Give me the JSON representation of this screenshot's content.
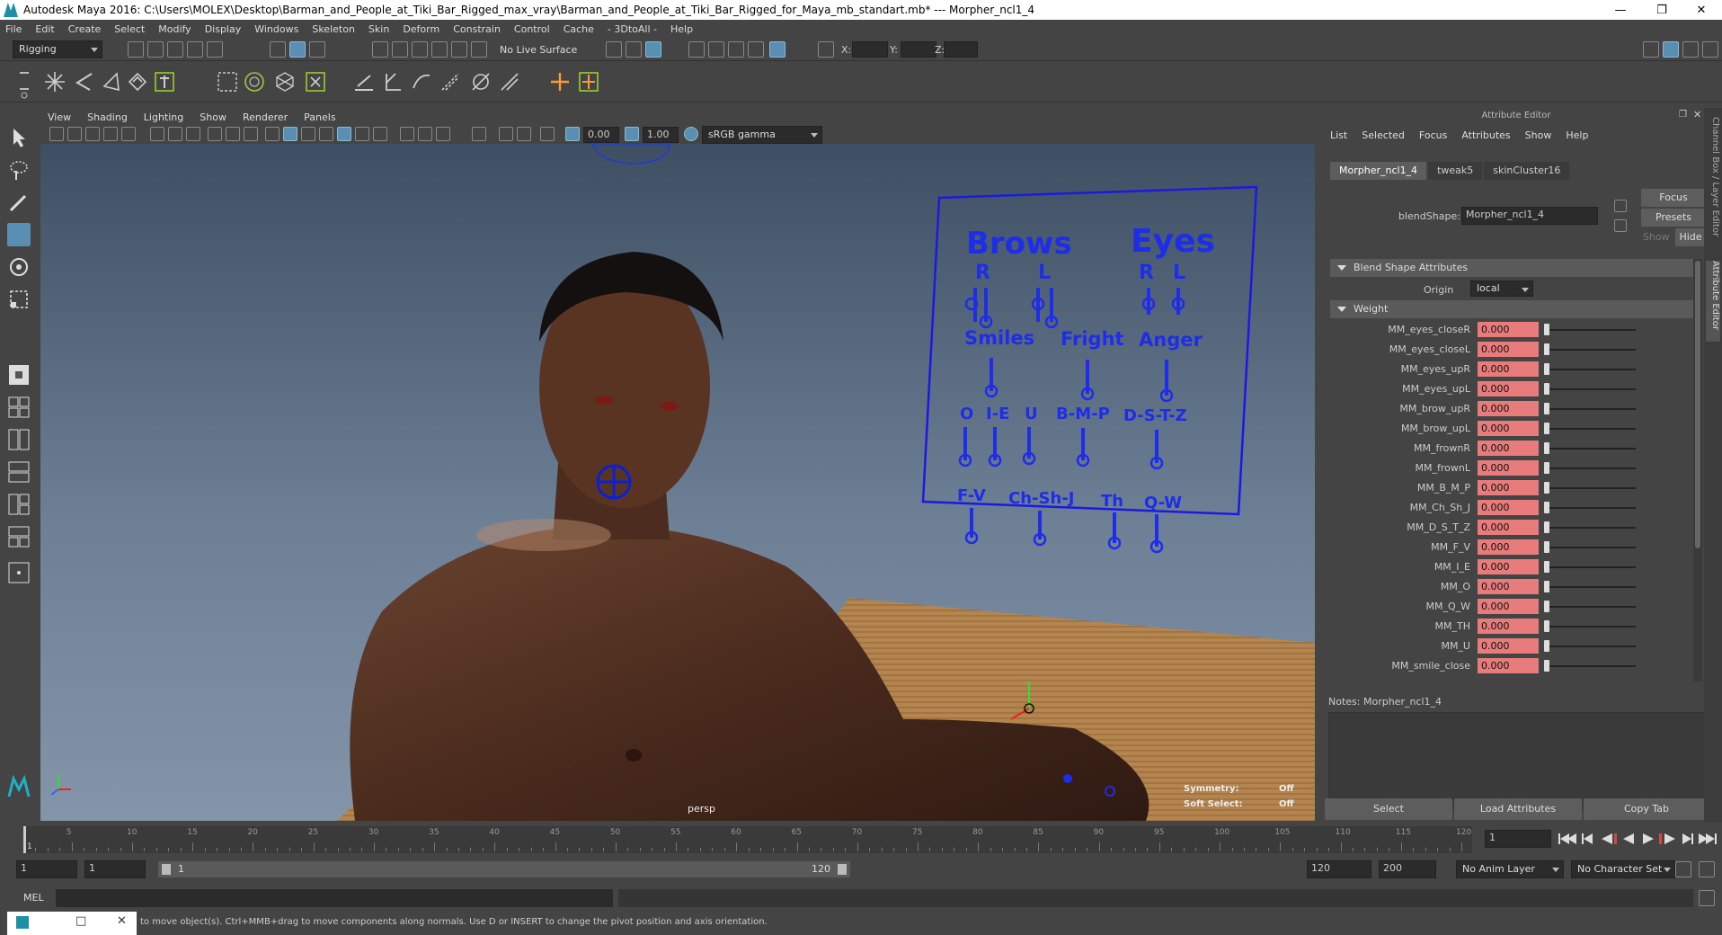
{
  "title": "Autodesk Maya 2016: C:\\Users\\MOLEX\\Desktop\\Barman_and_People_at_Tiki_Bar_Rigged_max_vray\\Barman_and_People_at_Tiki_Bar_Rigged_for_Maya_mb_standart.mb*   ---   Morpher_ncl1_4",
  "menus": [
    "File",
    "Edit",
    "Create",
    "Select",
    "Modify",
    "Display",
    "Windows",
    "Skeleton",
    "Skin",
    "Deform",
    "Constrain",
    "Control",
    "Cache",
    "- 3DtoAll -",
    "Help"
  ],
  "status": {
    "mode": "Rigging",
    "live_surface": "No Live Surface",
    "x_label": "X:",
    "y_label": "Y:",
    "z_label": "Z:"
  },
  "viewport": {
    "menus": [
      "View",
      "Shading",
      "Lighting",
      "Show",
      "Renderer",
      "Panels"
    ],
    "gamma_field": "0.00",
    "exposure_field": "1.00",
    "color_space": "sRGB gamma",
    "camera": "persp",
    "symmetry_label": "Symmetry:",
    "symmetry_value": "Off",
    "soft_select_label": "Soft Select:",
    "soft_select_value": "Off",
    "face_board": {
      "brows": "Brows",
      "eyes": "Eyes",
      "r1": "R",
      "l1": "L",
      "r2": "R",
      "l2": "L",
      "smiles": "Smiles",
      "fright": "Fright",
      "anger": "Anger",
      "o": "O",
      "ie": "I-E",
      "u": "U",
      "bmp": "B-M-P",
      "dstz": "D-S-T-Z",
      "fv": "F-V",
      "chshj": "Ch-Sh-J",
      "th": "Th",
      "qw": "Q-W"
    }
  },
  "attribute_editor": {
    "header": "Attribute Editor",
    "menus": [
      "List",
      "Selected",
      "Focus",
      "Attributes",
      "Show",
      "Help"
    ],
    "tabs": [
      "Morpher_ncl1_4",
      "tweak5",
      "skinCluster16"
    ],
    "blendshape_label": "blendShape:",
    "blendshape_value": "Morpher_ncl1_4",
    "focus_btn": "Focus",
    "presets_btn": "Presets",
    "show_label": "Show",
    "hide_btn": "Hide",
    "section_blend": "Blend Shape Attributes",
    "origin_label": "Origin",
    "origin_value": "local",
    "section_weight": "Weight",
    "weights": [
      {
        "name": "MM_eyes_closeR",
        "value": "0.000"
      },
      {
        "name": "MM_eyes_closeL",
        "value": "0.000"
      },
      {
        "name": "MM_eyes_upR",
        "value": "0.000"
      },
      {
        "name": "MM_eyes_upL",
        "value": "0.000"
      },
      {
        "name": "MM_brow_upR",
        "value": "0.000"
      },
      {
        "name": "MM_brow_upL",
        "value": "0.000"
      },
      {
        "name": "MM_frownR",
        "value": "0.000"
      },
      {
        "name": "MM_frownL",
        "value": "0.000"
      },
      {
        "name": "MM_B_M_P",
        "value": "0.000"
      },
      {
        "name": "MM_Ch_Sh_J",
        "value": "0.000"
      },
      {
        "name": "MM_D_S_T_Z",
        "value": "0.000"
      },
      {
        "name": "MM_F_V",
        "value": "0.000"
      },
      {
        "name": "MM_I_E",
        "value": "0.000"
      },
      {
        "name": "MM_O",
        "value": "0.000"
      },
      {
        "name": "MM_Q_W",
        "value": "0.000"
      },
      {
        "name": "MM_TH",
        "value": "0.000"
      },
      {
        "name": "MM_U",
        "value": "0.000"
      },
      {
        "name": "MM_smile_close",
        "value": "0.000"
      }
    ],
    "notes_label": "Notes:  Morpher_ncl1_4",
    "select_btn": "Select",
    "load_btn": "Load Attributes",
    "copy_btn": "Copy Tab",
    "side_tabs": [
      "Channel Box / Layer Editor",
      "Attribute Editor"
    ]
  },
  "timeline": {
    "ticks": [
      "5",
      "10",
      "15",
      "20",
      "25",
      "30",
      "35",
      "40",
      "45",
      "50",
      "55",
      "60",
      "65",
      "70",
      "75",
      "80",
      "85",
      "90",
      "95",
      "100",
      "105",
      "110",
      "115",
      "120"
    ],
    "start_marker": "1",
    "current_frame": "1"
  },
  "range": {
    "start": "1",
    "playback_start": "1",
    "range_start": "1",
    "range_end": "120",
    "playback_end": "120",
    "end": "200",
    "anim_layer": "No Anim Layer",
    "character_set": "No Character Set"
  },
  "cmd": {
    "mel_label": "MEL"
  },
  "help_text": "to move object(s). Ctrl+MMB+drag to move components along normals. Use D or INSERT to change the pivot position and axis orientation."
}
